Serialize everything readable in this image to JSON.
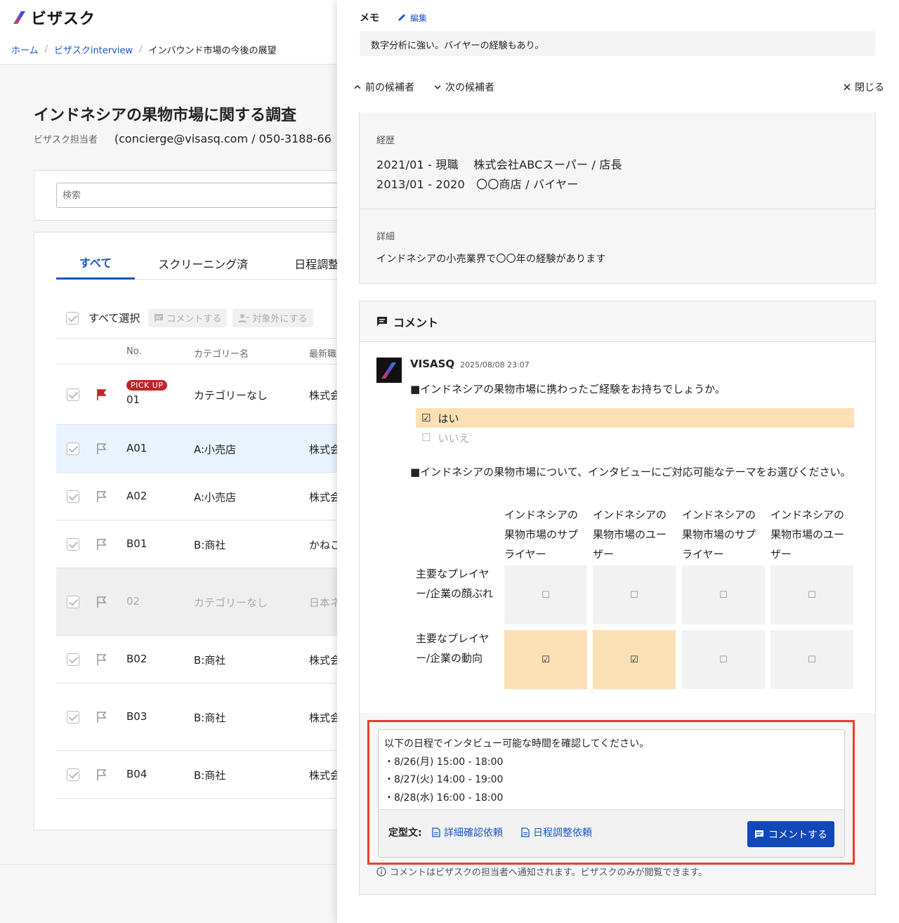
{
  "app": {
    "logo_text": "ビザスク"
  },
  "breadcrumb": {
    "items": [
      "ホーム",
      "ビザスクinterview",
      "インバウンド市場の今後の展望"
    ]
  },
  "project": {
    "title": "インドネシアの果物市場に関する調査",
    "rep_label": "ビザスク担当者",
    "rep_value": "(concierge@visasq.com / 050-3188-66"
  },
  "search": {
    "placeholder": "検索"
  },
  "tabs": [
    "すべて",
    "スクリーニング済",
    "日程調整"
  ],
  "toolbar": {
    "select_all": "すべて選択",
    "comment": "コメントする",
    "exclude": "対象外にする"
  },
  "table": {
    "headers": [
      "No.",
      "カテゴリー名",
      "最新職"
    ],
    "rows": [
      {
        "badge": "PICK UP",
        "no": "01",
        "cat": "カテゴリーなし",
        "co": "株式会"
      },
      {
        "no": "A01",
        "cat": "A:小売店",
        "co": "株式会"
      },
      {
        "no": "A02",
        "cat": "A:小売店",
        "co": "株式会"
      },
      {
        "no": "B01",
        "cat": "B:商社",
        "co": "かねこ"
      },
      {
        "no": "02",
        "cat": "カテゴリーなし",
        "co": "日本ネ"
      },
      {
        "no": "B02",
        "cat": "B:商社",
        "co": "株式会"
      },
      {
        "no": "B03",
        "cat": "B:商社",
        "co": "株式会"
      },
      {
        "no": "B04",
        "cat": "B:商社",
        "co": "株式会"
      }
    ]
  },
  "panel": {
    "memo_title": "メモ",
    "memo_edit": "編集",
    "memo_text": "数字分析に強い。バイヤーの経験もあり。",
    "prev": "前の候補者",
    "next": "次の候補者",
    "close": "閉じる",
    "career_label": "経歴",
    "career": [
      "2021/01 - 現職　 株式会社ABCスーパー / 店長",
      "2013/01 - 2020　〇〇商店 / バイヤー"
    ],
    "detail_label": "詳細",
    "detail_text": "インドネシアの小売業界で〇〇年の経験があります"
  },
  "comment": {
    "title": "コメント",
    "author": "VISASQ",
    "date": "2025/08/08 23:07",
    "q1": "■インドネシアの果物市場に携わったご経験をお持ちでしょうか。",
    "q1_options": [
      "はい",
      "いいえ"
    ],
    "q2": "■インドネシアの果物市場について、インタビューにご対応可能なテーマをお選びください。",
    "matrix_cols": [
      "インドネシアの果物市場のサプライヤー",
      "インドネシアの果物市場のユーザー",
      "インドネシアの果物市場のサプライヤー",
      "インドネシアの果物市場のユーザー"
    ],
    "matrix_rows": [
      "主要なプレイヤー/企業の顔ぶれ",
      "主要なプレイヤー/企業の動向"
    ],
    "composer_lines": [
      "以下の日程でインタビュー可能な時間を確認してください。",
      "・8/26(月) 15:00 - 18:00",
      "・8/27(火) 14:00 - 19:00",
      "・8/28(水) 16:00 - 18:00"
    ],
    "template_label": "定型文:",
    "template1": "詳細確認依頼",
    "template2": "日程調整依頼",
    "send": "コメントする",
    "notice": "コメントはビザスクの担当者へ通知されます。ビザスクのみが閲覧できます。"
  },
  "colors": {
    "accent": "#1a56c4",
    "send_button": "#1147b8",
    "highlight": "#fbe0b5",
    "pickup": "#c0262c",
    "composer_border": "#e8402a"
  }
}
